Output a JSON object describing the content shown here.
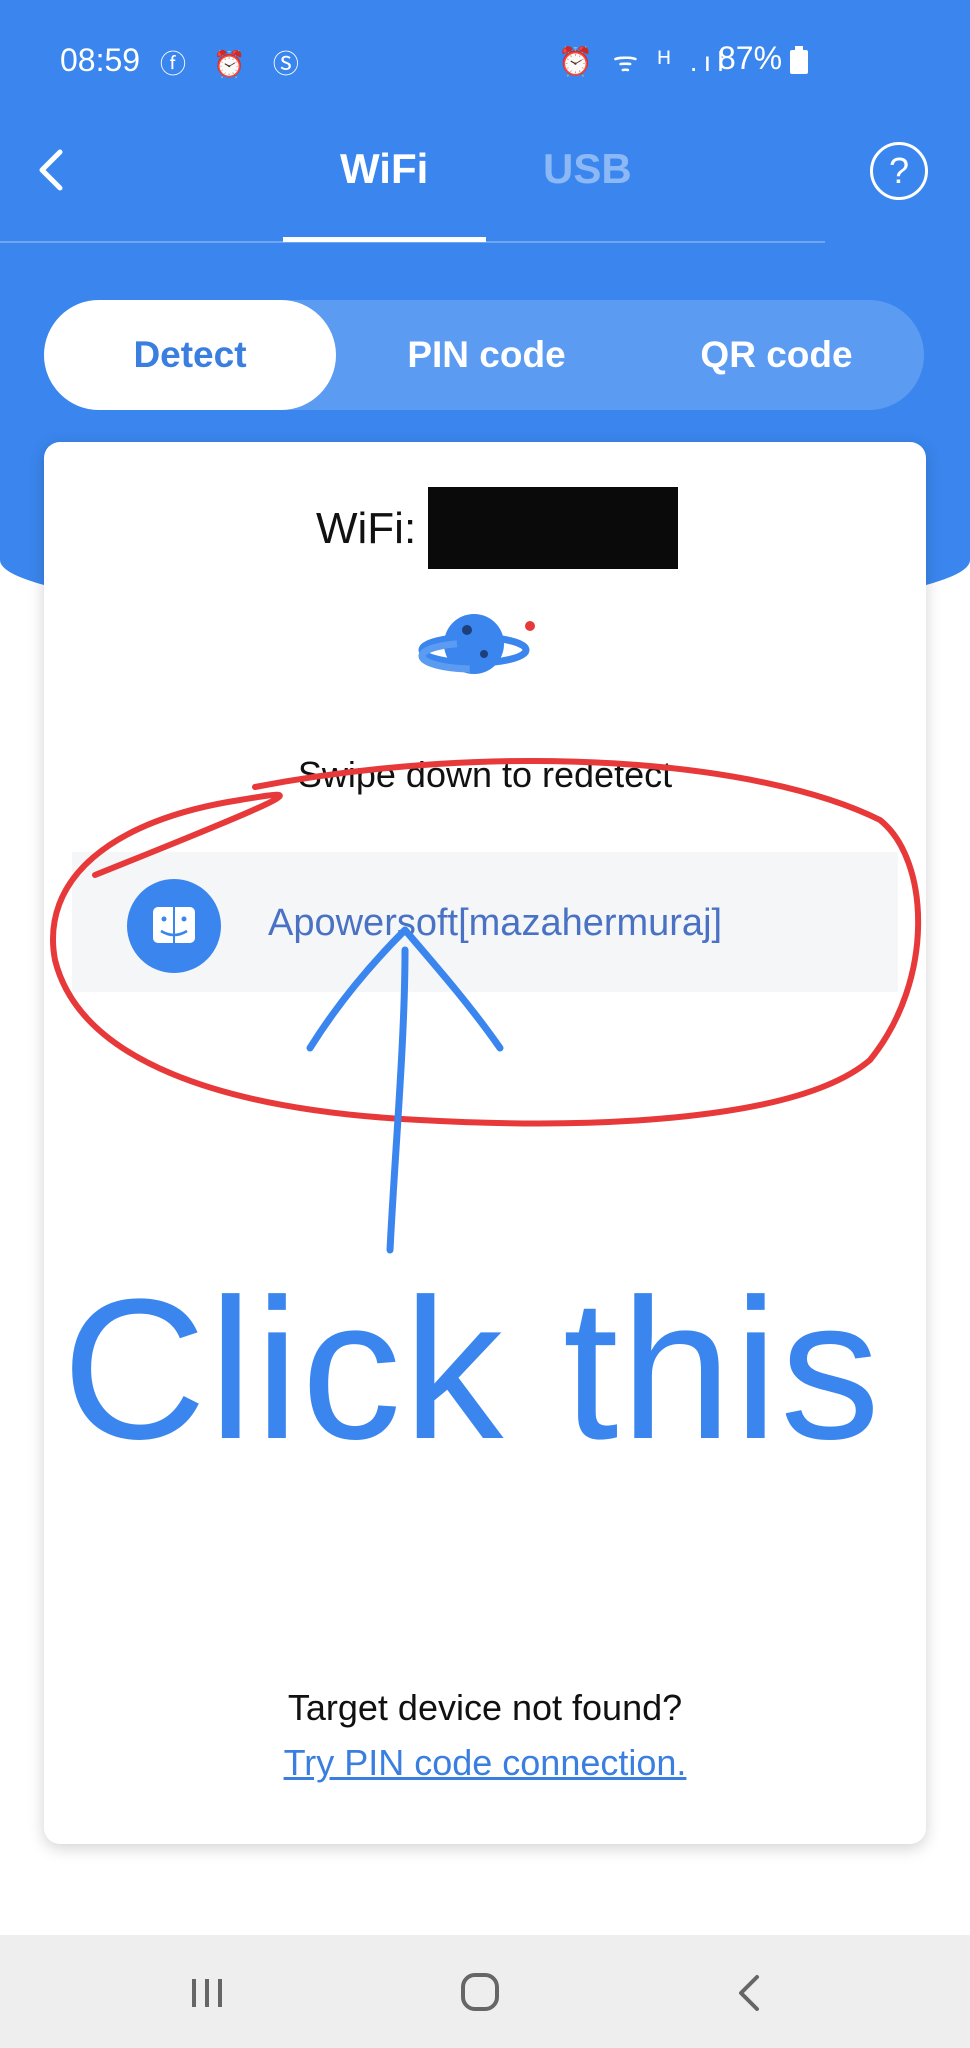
{
  "status_bar": {
    "time": "08:59",
    "left_icons": "ⓕ ⏰ Ⓢ",
    "right_icons": "⏰ ᯤ ᴴ .ıl",
    "battery": "87%"
  },
  "header": {
    "tabs": [
      {
        "label": "WiFi",
        "active": true
      },
      {
        "label": "USB",
        "active": false
      }
    ],
    "help": "?"
  },
  "segmented": {
    "items": [
      {
        "label": "Detect",
        "active": true
      },
      {
        "label": "PIN code",
        "active": false
      },
      {
        "label": "QR code",
        "active": false
      }
    ]
  },
  "card": {
    "wifi_label": "WiFi:",
    "swipe_hint": "Swipe down to redetect",
    "device_name": "Apowersoft[mazahermuraj]",
    "not_found": "Target device not found?",
    "try_pin_link": "Try PIN code connection."
  },
  "annotation": {
    "text": "Click this",
    "circle_color": "#e8393a",
    "arrow_color": "#3a86ee"
  },
  "colors": {
    "accent": "#3a86ee",
    "device_text": "#4a72c4"
  },
  "icons": {
    "back": "chevron-left-icon",
    "help": "help-circle-icon",
    "planet": "planet-icon",
    "device": "finder-icon"
  }
}
